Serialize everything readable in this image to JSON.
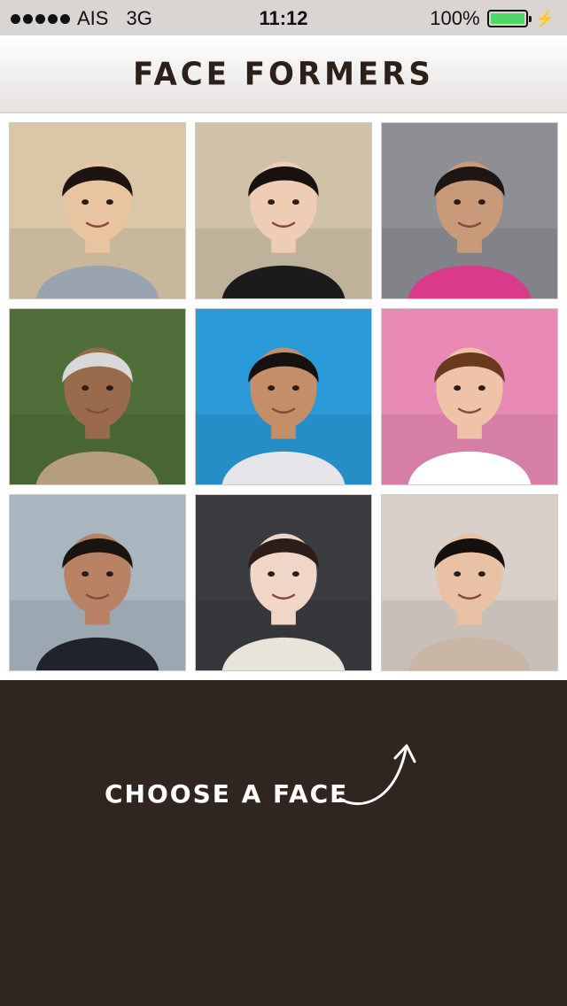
{
  "status_bar": {
    "carrier": "AIS",
    "network": "3G",
    "time": "11:12",
    "battery": "100%",
    "battery_level": 1.0
  },
  "header": {
    "title": "Face Formers"
  },
  "faces": [
    {
      "bg": "#d9c7a8",
      "skin": "#e9c4a0",
      "hair": "#1c1410",
      "shirt": "#9aa4b0"
    },
    {
      "bg": "#cfc2a8",
      "skin": "#efcdb4",
      "hair": "#18120f",
      "shirt": "#1b1b1b"
    },
    {
      "bg": "#8d8f94",
      "skin": "#c99a7a",
      "hair": "#1e1613",
      "shirt": "#d93a8a"
    },
    {
      "bg": "#4f6e3a",
      "skin": "#9a6a4c",
      "hair": "#d8d8d8",
      "shirt": "#b59e7e"
    },
    {
      "bg": "#2a9bd8",
      "skin": "#c48f68",
      "hair": "#16110e",
      "shirt": "#e6e6ea"
    },
    {
      "bg": "#e88ab5",
      "skin": "#efc3a8",
      "hair": "#6b3a1e",
      "shirt": "#ffffff"
    },
    {
      "bg": "#a9b6c0",
      "skin": "#b98264",
      "hair": "#1a1411",
      "shirt": "#20232a"
    },
    {
      "bg": "#3b3c40",
      "skin": "#f0d6c6",
      "hair": "#2b1e18",
      "shirt": "#e9e4da"
    },
    {
      "bg": "#d8d0c8",
      "skin": "#e9c2a6",
      "hair": "#15100d",
      "shirt": "#c9b6a4"
    }
  ],
  "footer": {
    "prompt": "Choose a face",
    "arrow_icon": "curved-arrow-icon"
  },
  "colors": {
    "panel": "#31261f",
    "title": "#2d2019",
    "battery": "#4cd964"
  }
}
